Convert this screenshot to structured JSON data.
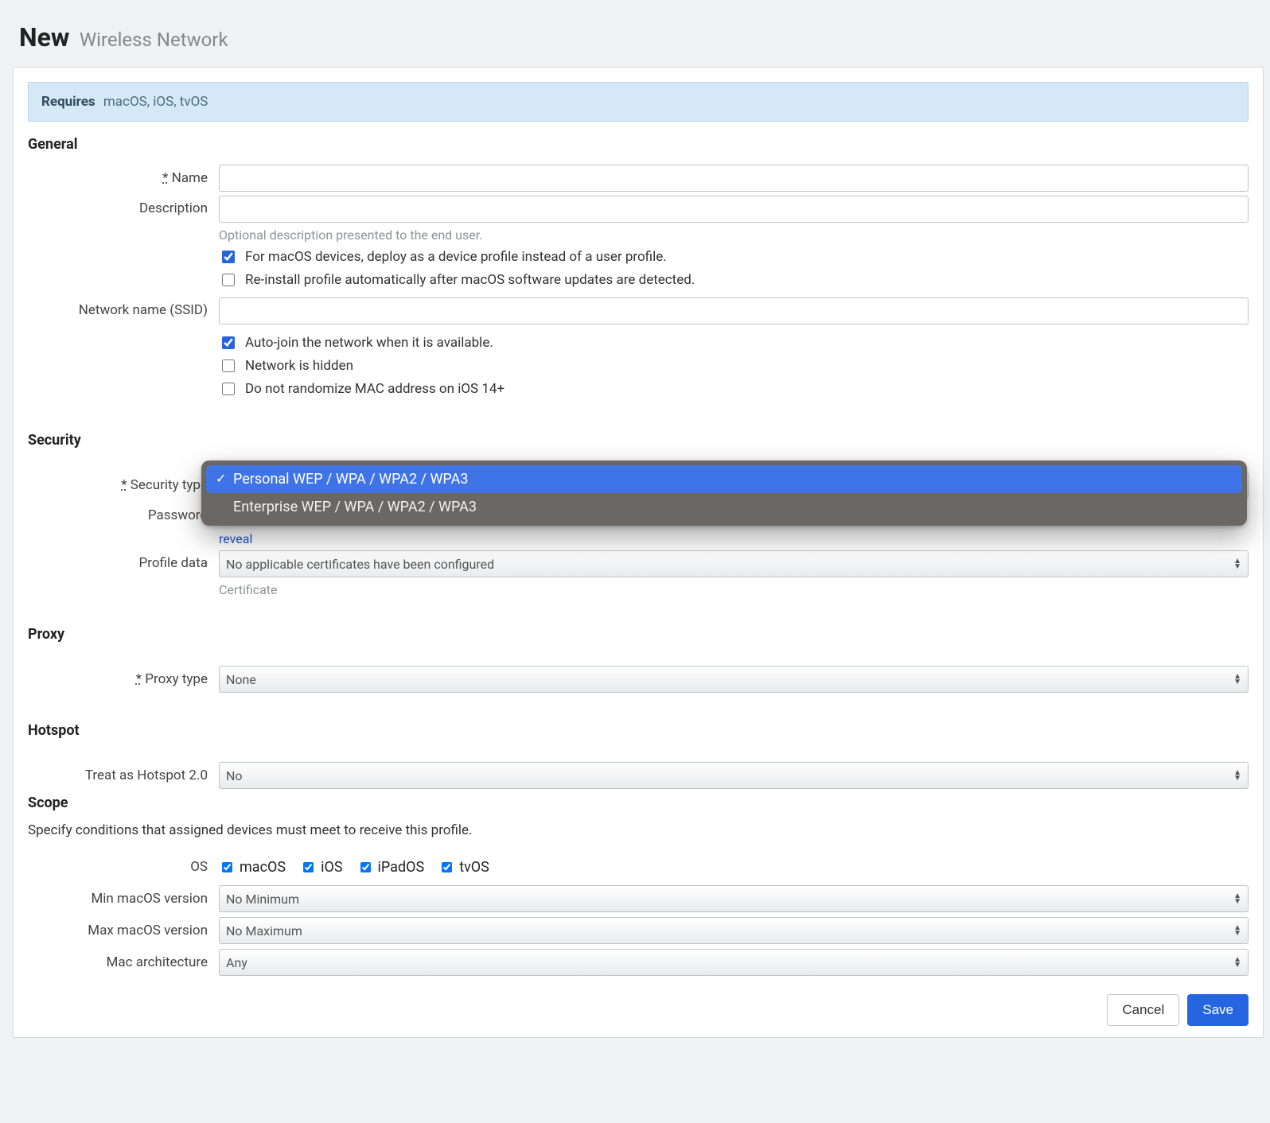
{
  "title": {
    "strong": "New",
    "sub": "Wireless Network"
  },
  "requires": {
    "label": "Requires",
    "os": "macOS, iOS, tvOS"
  },
  "sections": {
    "general": {
      "heading": "General",
      "name_label": "Name",
      "description_label": "Description",
      "description_hint": "Optional description presented to the end user.",
      "chk_device_profile": "For macOS devices, deploy as a device profile instead of a user profile.",
      "chk_reinstall": "Re-install profile automatically after macOS software updates are detected.",
      "ssid_label": "Network name (SSID)",
      "chk_autojoin": "Auto-join the network when it is available.",
      "chk_hidden": "Network is hidden",
      "chk_norandom_mac": "Do not randomize MAC address on iOS 14+"
    },
    "security": {
      "heading": "Security",
      "type_label": "Security type",
      "options": {
        "personal": "Personal WEP / WPA / WPA2 / WPA3",
        "enterprise": "Enterprise WEP / WPA / WPA2 / WPA3"
      },
      "password_label": "Password",
      "reveal_link": "reveal",
      "profile_data_label": "Profile data",
      "profile_data_value": "No applicable certificates have been configured",
      "profile_data_hint": "Certificate"
    },
    "proxy": {
      "heading": "Proxy",
      "type_label": "Proxy type",
      "type_value": "None"
    },
    "hotspot": {
      "heading": "Hotspot",
      "label": "Treat as Hotspot 2.0",
      "value": "No"
    },
    "scope": {
      "heading": "Scope",
      "description": "Specify conditions that assigned devices must meet to receive this profile.",
      "os_label": "OS",
      "os": {
        "macos": "macOS",
        "ios": "iOS",
        "ipados": "iPadOS",
        "tvos": "tvOS"
      },
      "min_macos_label": "Min macOS version",
      "min_macos_value": "No Minimum",
      "max_macos_label": "Max macOS version",
      "max_macos_value": "No Maximum",
      "arch_label": "Mac architecture",
      "arch_value": "Any"
    }
  },
  "actions": {
    "cancel": "Cancel",
    "save": "Save"
  }
}
